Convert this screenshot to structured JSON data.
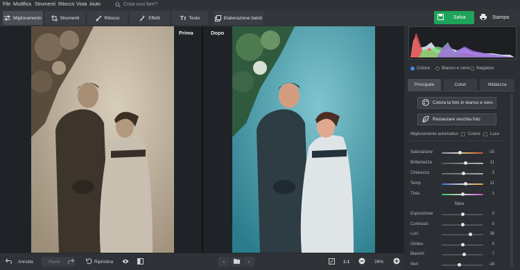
{
  "menu": {
    "items": [
      "File",
      "Modifica",
      "Strumenti",
      "Ritocco",
      "Vista",
      "Aiuto"
    ],
    "search_placeholder": "Cosa vuoi fare?"
  },
  "toolbar": {
    "tabs": [
      "Miglioramento",
      "Strumenti",
      "Ritocco",
      "Effetti",
      "Testo"
    ],
    "batch": "Elaborazione batch",
    "save": "Salva",
    "print": "Stampa"
  },
  "canvas": {
    "before_label": "Prima",
    "after_label": "Dopo"
  },
  "bottom": {
    "undo": "Annulla",
    "redo": "Ripeti",
    "reset": "Ripristina",
    "ratio": "1:1",
    "zoom": "26%"
  },
  "panel": {
    "modes": [
      "Colore",
      "Bianco e nero",
      "Negativo"
    ],
    "selected_mode": "Colore",
    "tabs": [
      "Principale",
      "Colori",
      "Nitidezza"
    ],
    "colorize_button": "Colora la foto in bianco e nero",
    "restore_button": "Restaurare vecchia foto",
    "auto_label": "Miglioramento automatico",
    "auto_color": "Colore",
    "auto_light": "Luce",
    "tone_heading": "Tono",
    "sliders": [
      {
        "label": "Saturazione",
        "value": "-15",
        "level": 0.43
      },
      {
        "label": "Brillantezza",
        "value": "11",
        "level": 0.56
      },
      {
        "label": "Chiarezza",
        "value": "3",
        "level": 0.52
      },
      {
        "label": "Temp",
        "value": "11",
        "level": 0.56
      },
      {
        "label": "Tinta",
        "value": "1",
        "level": 0.5
      }
    ],
    "tone_sliders": [
      {
        "label": "Esposizione",
        "value": "0",
        "level": 0.5
      },
      {
        "label": "Contrasto",
        "value": "0",
        "level": 0.5
      },
      {
        "label": "Luci",
        "value": "36",
        "level": 0.68
      },
      {
        "label": "Ombre",
        "value": "0",
        "level": 0.5
      },
      {
        "label": "Bianchi",
        "value": "7",
        "level": 0.54
      },
      {
        "label": "Neri",
        "value": "-18",
        "level": 0.41
      }
    ]
  },
  "colors": {
    "accent": "#3e8ede",
    "save_green": "#1fa35a"
  }
}
